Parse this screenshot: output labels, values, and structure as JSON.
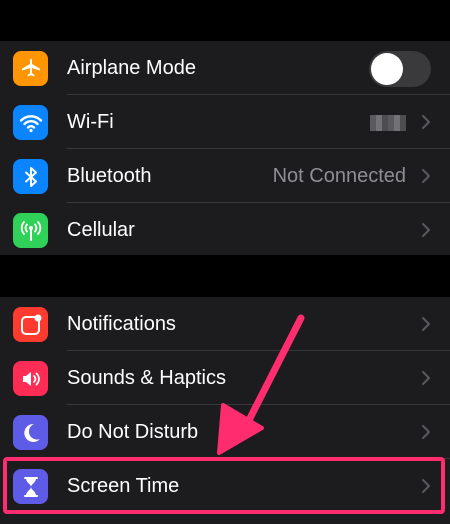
{
  "colors": {
    "background": "#000000",
    "group_background": "#1c1c1e",
    "secondary_text": "#8e8e93",
    "highlight": "#ff2d6f"
  },
  "settings": {
    "group1": [
      {
        "label": "Airplane Mode",
        "icon": "airplane-icon",
        "color": "#ff9500",
        "control": "toggle",
        "toggle_on": false
      },
      {
        "label": "Wi-Fi",
        "icon": "wifi-icon",
        "color": "#0a84ff",
        "value": "",
        "control": "chevron"
      },
      {
        "label": "Bluetooth",
        "icon": "bluetooth-icon",
        "color": "#0a84ff",
        "value": "Not Connected",
        "control": "chevron"
      },
      {
        "label": "Cellular",
        "icon": "cellular-icon",
        "color": "#30d158",
        "control": "chevron"
      }
    ],
    "group2": [
      {
        "label": "Notifications",
        "icon": "notifications-icon",
        "color": "#ff3b30",
        "control": "chevron"
      },
      {
        "label": "Sounds & Haptics",
        "icon": "speaker-icon",
        "color": "#ff2d55",
        "control": "chevron"
      },
      {
        "label": "Do Not Disturb",
        "icon": "moon-icon",
        "color": "#5e5ce6",
        "control": "chevron"
      },
      {
        "label": "Screen Time",
        "icon": "hourglass-icon",
        "color": "#5e5ce6",
        "control": "chevron"
      }
    ]
  }
}
